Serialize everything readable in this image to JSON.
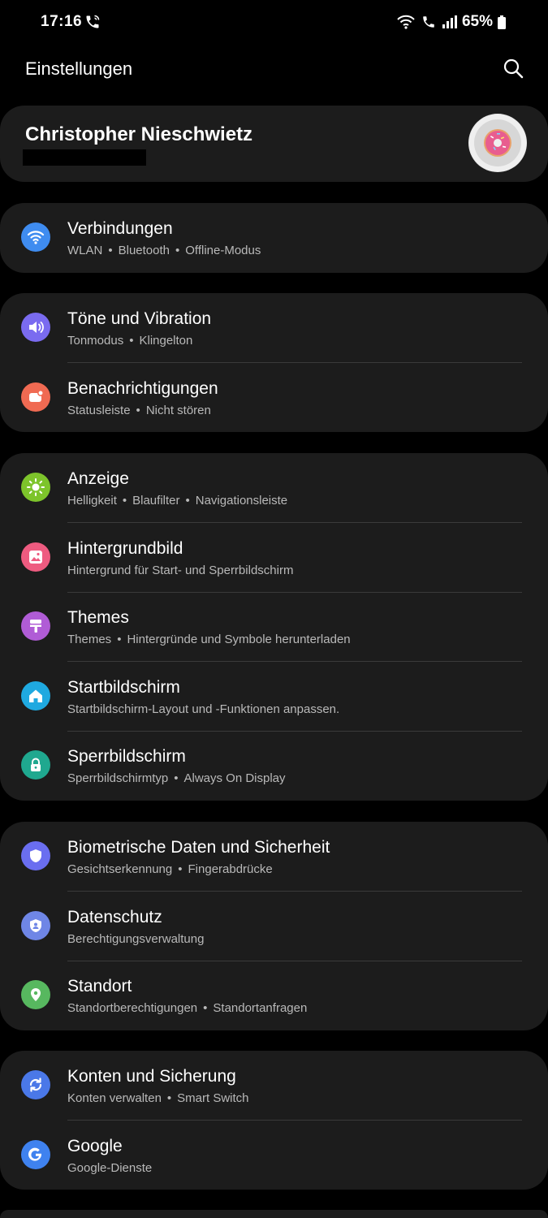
{
  "status_bar": {
    "time": "17:16",
    "battery": "65%"
  },
  "header": {
    "title": "Einstellungen"
  },
  "profile": {
    "name": "Christopher Nieschwietz"
  },
  "groups": [
    {
      "items": [
        {
          "title": "Verbindungen",
          "subtitle": [
            "WLAN",
            "Bluetooth",
            "Offline-Modus"
          ],
          "icon": "wifi-icon",
          "color": "#3f8cf0"
        }
      ]
    },
    {
      "items": [
        {
          "title": "Töne und Vibration",
          "subtitle": [
            "Tonmodus",
            "Klingelton"
          ],
          "icon": "volume-icon",
          "color": "#7a6bf0"
        },
        {
          "title": "Benachrichtigungen",
          "subtitle": [
            "Statusleiste",
            "Nicht stören"
          ],
          "icon": "notification-icon",
          "color": "#f06a52"
        }
      ]
    },
    {
      "items": [
        {
          "title": "Anzeige",
          "subtitle": [
            "Helligkeit",
            "Blaufilter",
            "Navigationsleiste"
          ],
          "icon": "sun-icon",
          "color": "#7dc42b"
        },
        {
          "title": "Hintergrundbild",
          "subtitle": [
            "Hintergrund für Start- und Sperrbildschirm"
          ],
          "icon": "image-icon",
          "color": "#ee5b80"
        },
        {
          "title": "Themes",
          "subtitle": [
            "Themes",
            "Hintergründe und Symbole herunterladen"
          ],
          "icon": "paintbrush-icon",
          "color": "#b05cd6"
        },
        {
          "title": "Startbildschirm",
          "subtitle": [
            "Startbildschirm-Layout und -Funktionen anpassen."
          ],
          "icon": "home-icon",
          "color": "#1fa9e0"
        },
        {
          "title": "Sperrbildschirm",
          "subtitle": [
            "Sperrbildschirmtyp",
            "Always On Display"
          ],
          "icon": "lock-icon",
          "color": "#1fa88f"
        }
      ]
    },
    {
      "items": [
        {
          "title": "Biometrische Daten und Sicherheit",
          "subtitle": [
            "Gesichtserkennung",
            "Fingerabdrücke"
          ],
          "icon": "shield-icon",
          "color": "#6a6ef0"
        },
        {
          "title": "Datenschutz",
          "subtitle": [
            "Berechtigungsverwaltung"
          ],
          "icon": "privacy-icon",
          "color": "#6f86e6"
        },
        {
          "title": "Standort",
          "subtitle": [
            "Standortberechtigungen",
            "Standortanfragen"
          ],
          "icon": "location-icon",
          "color": "#57b85f"
        }
      ]
    },
    {
      "items": [
        {
          "title": "Konten und Sicherung",
          "subtitle": [
            "Konten verwalten",
            "Smart Switch"
          ],
          "icon": "sync-icon",
          "color": "#4a78e8"
        },
        {
          "title": "Google",
          "subtitle": [
            "Google-Dienste"
          ],
          "icon": "google-icon",
          "color": "#3f82ef"
        }
      ]
    }
  ]
}
